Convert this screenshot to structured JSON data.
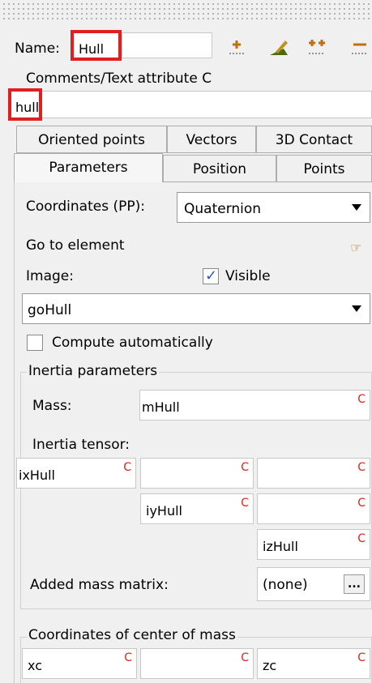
{
  "header": {
    "name_label": "Name:",
    "name_value": "Hull",
    "comments_label": "Comments/Text attribute C",
    "comments_value": "hull",
    "toolbar_icons": [
      "add-point-icon",
      "edit-element-icon",
      "add-multiple-icon",
      "remove-icon"
    ]
  },
  "tabs_row1": [
    "Oriented points",
    "Vectors",
    "3D Contact"
  ],
  "tabs_row2": [
    "Parameters",
    "Position",
    "Points"
  ],
  "active_tab": "Parameters",
  "params": {
    "coordinates_label": "Coordinates (PP):",
    "coordinates_value": "Quaternion",
    "goto_label": "Go to element",
    "image_label": "Image:",
    "visible_label": "Visible",
    "visible_checked": true,
    "image_value": "goHull",
    "compute_label": "Compute automatically",
    "compute_checked": false
  },
  "inertia": {
    "legend": "Inertia parameters",
    "mass_label": "Mass:",
    "mass_value": "mHull",
    "tensor_label": "Inertia tensor:",
    "tensor": [
      [
        "ixHull",
        "",
        ""
      ],
      [
        "",
        "iyHull",
        ""
      ],
      [
        "",
        "",
        "izHull"
      ]
    ],
    "c_marker": "C",
    "added_mass_label": "Added mass matrix:",
    "added_mass_value": "(none)",
    "more_label": "..."
  },
  "com": {
    "legend": "Coordinates of center of mass",
    "values": [
      "xc",
      "",
      "zc"
    ]
  },
  "colors": {
    "highlight": "#e02020",
    "c_marker": "#e02020",
    "check": "#2a57c8"
  }
}
